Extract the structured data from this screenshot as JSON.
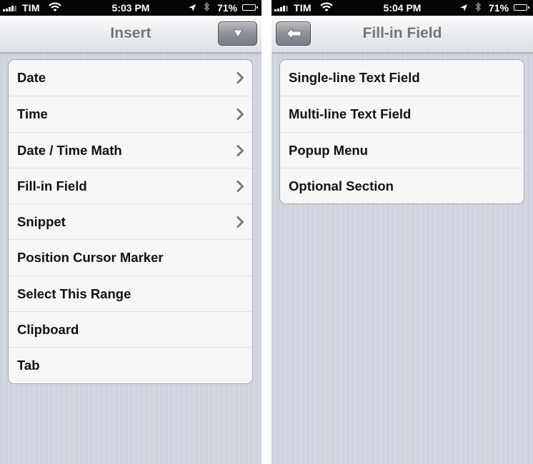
{
  "left_screen": {
    "status": {
      "carrier": "TIM",
      "time": "5:03 PM",
      "battery": "71%"
    },
    "nav": {
      "title": "Insert"
    },
    "items": [
      {
        "label": "Date",
        "disclosure": true
      },
      {
        "label": "Time",
        "disclosure": true
      },
      {
        "label": "Date / Time Math",
        "disclosure": true
      },
      {
        "label": "Fill-in Field",
        "disclosure": true
      },
      {
        "label": "Snippet",
        "disclosure": true
      },
      {
        "label": "Position Cursor Marker",
        "disclosure": false
      },
      {
        "label": "Select This Range",
        "disclosure": false
      },
      {
        "label": "Clipboard",
        "disclosure": false
      },
      {
        "label": "Tab",
        "disclosure": false
      }
    ]
  },
  "right_screen": {
    "status": {
      "carrier": "TIM",
      "time": "5:04 PM",
      "battery": "71%"
    },
    "nav": {
      "title": "Fill-in Field"
    },
    "items": [
      {
        "label": "Single-line Text Field"
      },
      {
        "label": "Multi-line Text Field"
      },
      {
        "label": "Popup Menu"
      },
      {
        "label": "Optional Section"
      }
    ]
  },
  "battery_level": 0.71,
  "colors": {
    "status_bar": "#050505",
    "nav_title": "#6f747d",
    "background": "#cdd2dc",
    "cell": "#f7f7f7"
  },
  "icons": [
    "signal-bars-icon",
    "wifi-icon",
    "location-arrow-icon",
    "bluetooth-icon",
    "battery-icon",
    "dropdown-triangle-icon",
    "back-arrow-icon",
    "chevron-right-icon"
  ]
}
